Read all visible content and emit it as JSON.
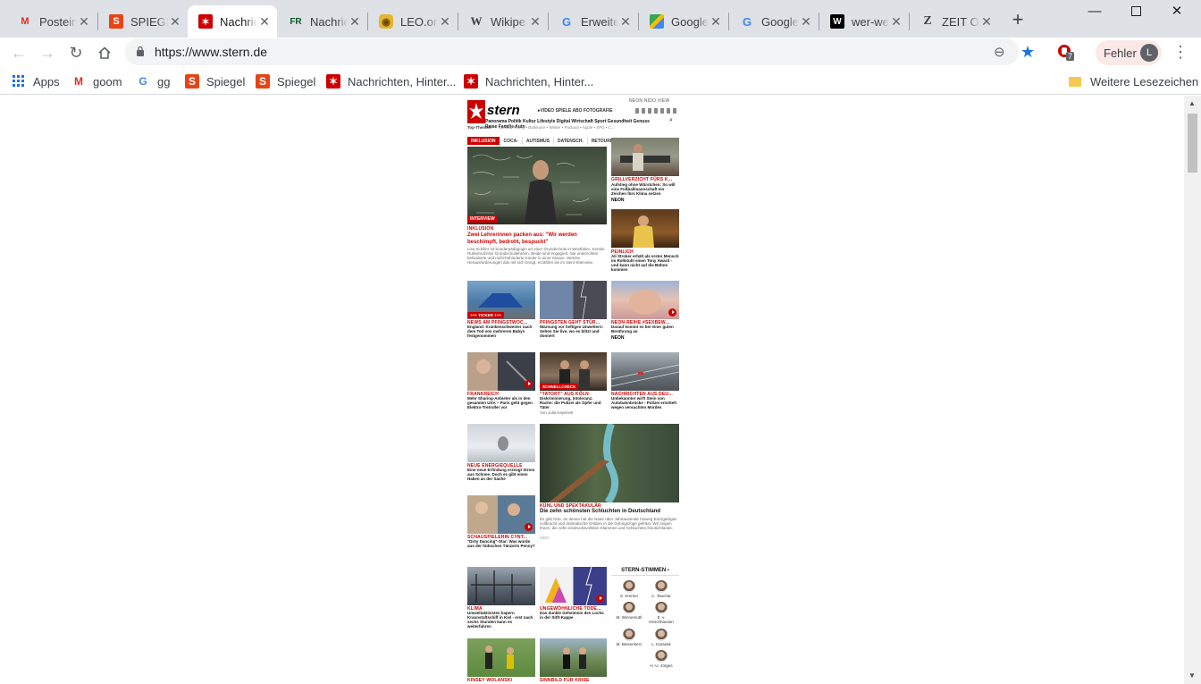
{
  "browser": {
    "tabs": [
      {
        "label": "Postein",
        "icon": "gmail-icon",
        "active": false
      },
      {
        "label": "SPIEGEL",
        "icon": "spiegel-icon",
        "active": false
      },
      {
        "label": "Nachric",
        "icon": "stern-icon",
        "active": true
      },
      {
        "label": "Nachric",
        "icon": "fr-icon",
        "active": false
      },
      {
        "label": "LEO.org",
        "icon": "leo-icon",
        "active": false
      },
      {
        "label": "Wikipe",
        "icon": "wikipedia-icon",
        "active": false
      },
      {
        "label": "Erweite",
        "icon": "google-icon",
        "active": false
      },
      {
        "label": "Google",
        "icon": "google-maps-icon",
        "active": false
      },
      {
        "label": "Google",
        "icon": "google-icon",
        "active": false
      },
      {
        "label": "wer-we",
        "icon": "wer-weiss-was-icon",
        "active": false
      },
      {
        "label": "ZEIT O",
        "icon": "zeit-icon",
        "active": false
      }
    ],
    "new_tab": "+",
    "url": "https://www.stern.de",
    "error_label": "Fehler",
    "profile_initial": "L",
    "extension_badge": "7",
    "bookmarks": [
      {
        "label": "Apps",
        "icon": "apps-grid-icon"
      },
      {
        "label": "goom",
        "icon": "gmail-icon"
      },
      {
        "label": "gg",
        "icon": "google-icon"
      },
      {
        "label": "Spiegel",
        "icon": "spiegel-icon"
      },
      {
        "label": "Spiegel",
        "icon": "spiegel-icon"
      },
      {
        "label": "Nachrichten, Hinter...",
        "icon": "stern-icon"
      },
      {
        "label": "Nachrichten, Hinter...",
        "icon": "stern-icon"
      }
    ],
    "other_bookmarks": "Weitere Lesezeichen"
  },
  "stern": {
    "logo": "stern",
    "topnav": "NEON   NIDO   VIEW",
    "subnav": "▸VIDEO  SPIELE  ABO  FOTOGRAFIE",
    "mainnav": "Panorama  Politik  Kultur  Lifestyle  Digital  Wirtschaft  Sport  Gesundheit  Genuss",
    "mainnav2": "Reise  Familie  Auto",
    "trend_label": "Top-Themen",
    "trend": "Donald Trump • Baltimore • Wetter • Podcast • Apple • SPD • C...",
    "tags": [
      "INKLUSION",
      "COCA-",
      "AUTISMUS",
      "DATENSCH.",
      "RETOUREN"
    ],
    "lead": {
      "badge": "INTERVIEW",
      "kicker": "INKLUSION",
      "headline": "Zwei Lehrerinnen packen aus: \"Wir werden beschimpft, bedroht, bespuckt\"",
      "teaser": "Lisa Schiller ist Sonderpädagogin an einer Grundschule in Westfalen. Kerstin Ruthenschröer Grundschullehrerin. Beide sind engagiert. Sie unterrichten behinderte und nicht-behinderte Kinder in einer Klasse. Welche Herausforderungen das mit sich bringt, erzählen sie im stern-Interview."
    },
    "side1": {
      "kicker": "GRILLVERZICHT FÜRS K...",
      "headline": "Aufstieg ohne Würstchen: So will eine Fußballmannschaft ein Zeichen fürs Klima setzen",
      "source": "NEON"
    },
    "side2": {
      "kicker": "PEINLICH",
      "headline": "Ali Stroker erhält als erster Mensch im Rollstuhl einen Tony Award - und kann nicht auf die Bühne kommen"
    },
    "row2": [
      {
        "badge": "+++ TICKER +++",
        "kicker": "NEWS AM PFINGSTWOC...",
        "headline": "England: Krankenschwester nach dem Tod von mehreren Babys festgenommen"
      },
      {
        "kicker": "PFINGSTEN GEHT STÜR...",
        "headline": "Warnung vor heftigen Unwettern: Sehen Sie live, wo es blitzt und donnert"
      },
      {
        "kicker": "NEON-REIHE #SEXBEW...",
        "headline": "Darauf kommt es bei einer guten Berührung an",
        "source": "NEON"
      }
    ],
    "row3": [
      {
        "kicker": "FRANKREICH",
        "headline": "Mehr Sharing-Anbieter als in den gesamten USA – Paris geht gegen Elektro-Tretroller vor"
      },
      {
        "badge": "SCHNELLCHECK",
        "kicker": "\"TATORT\" AUS KÖLN",
        "headline": "Diskriminierung, Intoleranz, Rache: die Polizei als Opfer und Täter",
        "author": "Von Julia Kepenek"
      },
      {
        "kicker": "NACHRICHTEN AUS DEU...",
        "headline": "Unbekannter wirft Stein von Autobahnbrücke - Polizei ermittelt wegen versuchten Mordes"
      }
    ],
    "row4_left": {
      "kicker": "NEUE ENERGIEQUELLE",
      "headline": "Eine neue Erfindung erzeugt Strom aus Schnee. Doch es gibt einen Haken an der Sache"
    },
    "row4_big": {
      "kicker": "KÜHL UND SPEKTAKULÄR",
      "headline": "Die zehn schönsten Schluchten in Deutschland",
      "teaser": "Es gibt Orte, an denen hat die Natur über Jahrtausende hinweg Einzigartiges vollbracht und dramatische Gräben in die Gebirgszüge gefräst. Wir zeigen Ihnen, die zehn eindrucksvollsten Klammen und Schluchten Deutschlands.",
      "source": "GEO"
    },
    "row5_left": {
      "kicker": "SCHAUSPIELERIN CYNT...",
      "headline": "\"Dirty Dancing\"-Star: Was wurde aus der hübschen Tänzerin Penny?"
    },
    "row6": [
      {
        "kicker": "KLIMA",
        "headline": "Umweltaktivisten kapern Kraunstaftschiff in Kiel - erst nach sechs Stunden kann es weiterfahren"
      },
      {
        "kicker": "UNGEWÖHNLICHE TODE...",
        "headline": "Das dunkle Geheimnis des Lochs in der Sitft-Kappe"
      }
    ],
    "row7": [
      {
        "kicker": "KINSEY WOLANSKI"
      },
      {
        "kicker": "SINNBILD FÜR KRISE"
      }
    ],
    "stimmen": {
      "title": "STERN-STIMMEN ›",
      "people": [
        "S. Kremer",
        "C. Tauchar",
        "M. Winnemuth",
        "E. v. Hirschhausen",
        "M. Beisenherz",
        "L. Karasek",
        "H.-U. Jörges"
      ]
    }
  }
}
